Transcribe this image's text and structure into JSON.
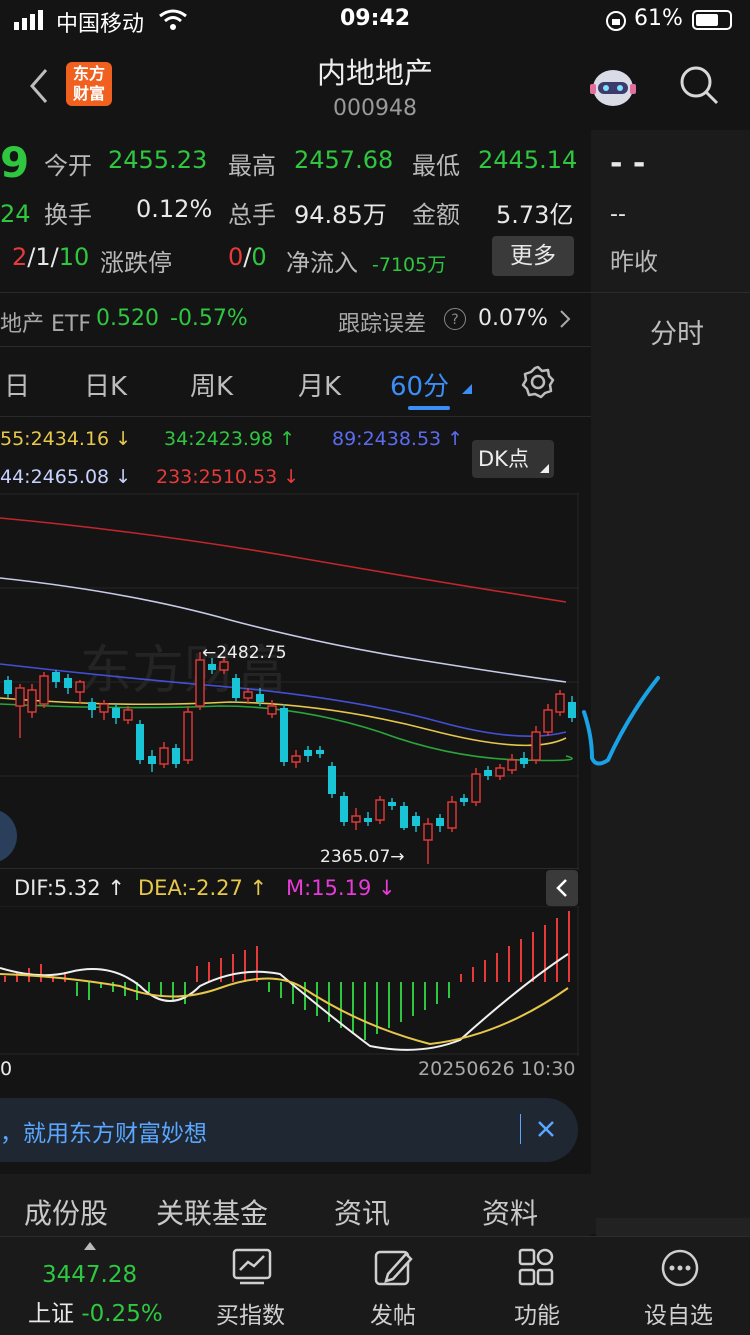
{
  "status_bar": {
    "carrier": "中国移动",
    "time": "09:42",
    "battery": "61%"
  },
  "header": {
    "logo_text": "东方财富",
    "title": "内地地产",
    "code": "000948"
  },
  "quote": {
    "price_partial": "9",
    "change_partial": "24",
    "open_label": "今开",
    "open_value": "2455.23",
    "high_label": "最高",
    "high_value": "2457.68",
    "low_label": "最低",
    "low_value": "2445.14",
    "turnover_label": "换手",
    "turnover_value": "0.12%",
    "volume_label": "总手",
    "volume_value": "94.85万",
    "amount_label": "金额",
    "amount_value": "5.73亿",
    "updown_a": "2",
    "updown_b": "1",
    "updown_c": "10",
    "limit_label": "涨跌停",
    "limit_a": "0",
    "limit_b": "0",
    "netflow_label": "净流入",
    "netflow_value": "-7105万",
    "more_label": "更多"
  },
  "etf_row": {
    "name": "地产 ETF",
    "price": "0.520",
    "change": "-0.57%",
    "tracking_label": "跟踪误差",
    "tracking_value": "0.07%"
  },
  "right_panel": {
    "dash1": "- -",
    "dash2": "--",
    "prev_close_label": "昨收",
    "tab_label": "分时"
  },
  "period_tabs": [
    "日",
    "日K",
    "周K",
    "月K",
    "60分"
  ],
  "active_tab": "60分",
  "ma_labels": {
    "ma55": "55:2434.16 ↓",
    "ma34": "34:2423.98 ↑",
    "ma89": "89:2438.53 ↑",
    "ma144": "44:2465.08 ↓",
    "ma233": "233:2510.53 ↓",
    "dk_label": "DK点"
  },
  "chart_labels": {
    "high_mark": "←2482.75",
    "low_mark": "2365.07→",
    "watermark": "东方财富"
  },
  "macd": {
    "dif": "DIF:5.32 ↑",
    "dea": "DEA:-2.27 ↑",
    "m": "M:15.19 ↓",
    "date_left": "0",
    "date_right": "20250626 10:30"
  },
  "banner": {
    "text": "，就用东方财富妙想"
  },
  "bottom_tabs": [
    "成份股",
    "关联基金",
    "资讯",
    "资料"
  ],
  "tabbar": {
    "index_value": "3447.28",
    "index_name": "上证",
    "index_change": "-0.25%",
    "items": [
      "买指数",
      "发帖",
      "功能",
      "设自选"
    ]
  },
  "chart_data": {
    "type": "candlestick",
    "annotations": [
      "←2482.75",
      "2365.07→"
    ],
    "series": [
      {
        "name": "55",
        "last": 2434.16
      },
      {
        "name": "34",
        "last": 2423.98
      },
      {
        "name": "89",
        "last": 2438.53
      },
      {
        "name": "233",
        "last": 2510.53
      }
    ],
    "macd": {
      "DIF": 5.32,
      "DEA": -2.27,
      "M": 15.19
    }
  }
}
